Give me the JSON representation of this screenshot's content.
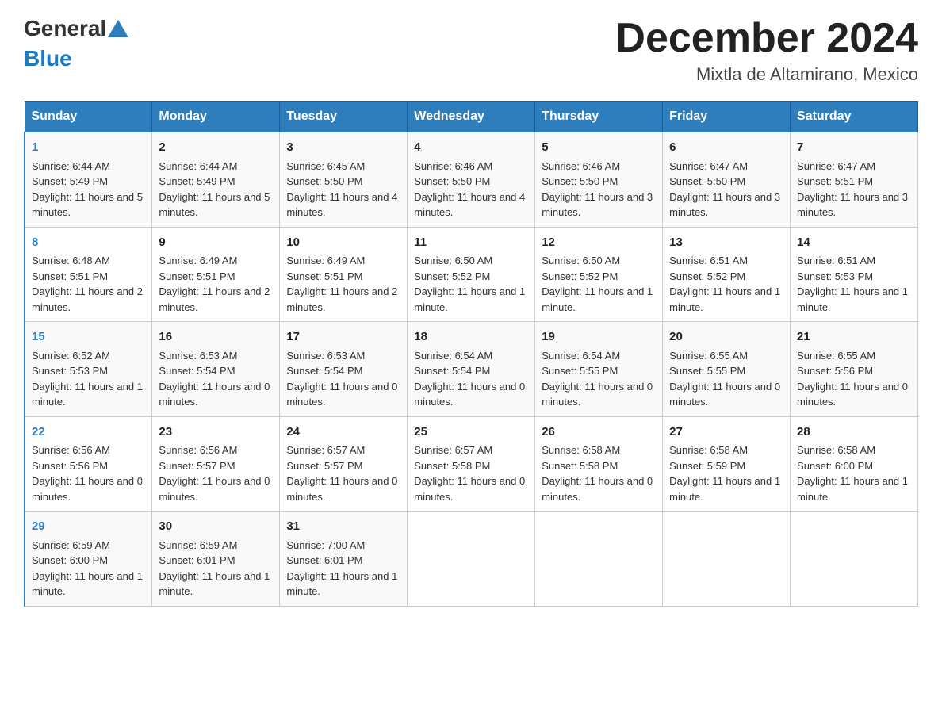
{
  "header": {
    "logo_general": "General",
    "logo_blue": "Blue",
    "title": "December 2024",
    "subtitle": "Mixtla de Altamirano, Mexico"
  },
  "days_of_week": [
    "Sunday",
    "Monday",
    "Tuesday",
    "Wednesday",
    "Thursday",
    "Friday",
    "Saturday"
  ],
  "weeks": [
    [
      {
        "day": "1",
        "sunrise": "6:44 AM",
        "sunset": "5:49 PM",
        "daylight": "11 hours and 5 minutes."
      },
      {
        "day": "2",
        "sunrise": "6:44 AM",
        "sunset": "5:49 PM",
        "daylight": "11 hours and 5 minutes."
      },
      {
        "day": "3",
        "sunrise": "6:45 AM",
        "sunset": "5:50 PM",
        "daylight": "11 hours and 4 minutes."
      },
      {
        "day": "4",
        "sunrise": "6:46 AM",
        "sunset": "5:50 PM",
        "daylight": "11 hours and 4 minutes."
      },
      {
        "day": "5",
        "sunrise": "6:46 AM",
        "sunset": "5:50 PM",
        "daylight": "11 hours and 3 minutes."
      },
      {
        "day": "6",
        "sunrise": "6:47 AM",
        "sunset": "5:50 PM",
        "daylight": "11 hours and 3 minutes."
      },
      {
        "day": "7",
        "sunrise": "6:47 AM",
        "sunset": "5:51 PM",
        "daylight": "11 hours and 3 minutes."
      }
    ],
    [
      {
        "day": "8",
        "sunrise": "6:48 AM",
        "sunset": "5:51 PM",
        "daylight": "11 hours and 2 minutes."
      },
      {
        "day": "9",
        "sunrise": "6:49 AM",
        "sunset": "5:51 PM",
        "daylight": "11 hours and 2 minutes."
      },
      {
        "day": "10",
        "sunrise": "6:49 AM",
        "sunset": "5:51 PM",
        "daylight": "11 hours and 2 minutes."
      },
      {
        "day": "11",
        "sunrise": "6:50 AM",
        "sunset": "5:52 PM",
        "daylight": "11 hours and 1 minute."
      },
      {
        "day": "12",
        "sunrise": "6:50 AM",
        "sunset": "5:52 PM",
        "daylight": "11 hours and 1 minute."
      },
      {
        "day": "13",
        "sunrise": "6:51 AM",
        "sunset": "5:52 PM",
        "daylight": "11 hours and 1 minute."
      },
      {
        "day": "14",
        "sunrise": "6:51 AM",
        "sunset": "5:53 PM",
        "daylight": "11 hours and 1 minute."
      }
    ],
    [
      {
        "day": "15",
        "sunrise": "6:52 AM",
        "sunset": "5:53 PM",
        "daylight": "11 hours and 1 minute."
      },
      {
        "day": "16",
        "sunrise": "6:53 AM",
        "sunset": "5:54 PM",
        "daylight": "11 hours and 0 minutes."
      },
      {
        "day": "17",
        "sunrise": "6:53 AM",
        "sunset": "5:54 PM",
        "daylight": "11 hours and 0 minutes."
      },
      {
        "day": "18",
        "sunrise": "6:54 AM",
        "sunset": "5:54 PM",
        "daylight": "11 hours and 0 minutes."
      },
      {
        "day": "19",
        "sunrise": "6:54 AM",
        "sunset": "5:55 PM",
        "daylight": "11 hours and 0 minutes."
      },
      {
        "day": "20",
        "sunrise": "6:55 AM",
        "sunset": "5:55 PM",
        "daylight": "11 hours and 0 minutes."
      },
      {
        "day": "21",
        "sunrise": "6:55 AM",
        "sunset": "5:56 PM",
        "daylight": "11 hours and 0 minutes."
      }
    ],
    [
      {
        "day": "22",
        "sunrise": "6:56 AM",
        "sunset": "5:56 PM",
        "daylight": "11 hours and 0 minutes."
      },
      {
        "day": "23",
        "sunrise": "6:56 AM",
        "sunset": "5:57 PM",
        "daylight": "11 hours and 0 minutes."
      },
      {
        "day": "24",
        "sunrise": "6:57 AM",
        "sunset": "5:57 PM",
        "daylight": "11 hours and 0 minutes."
      },
      {
        "day": "25",
        "sunrise": "6:57 AM",
        "sunset": "5:58 PM",
        "daylight": "11 hours and 0 minutes."
      },
      {
        "day": "26",
        "sunrise": "6:58 AM",
        "sunset": "5:58 PM",
        "daylight": "11 hours and 0 minutes."
      },
      {
        "day": "27",
        "sunrise": "6:58 AM",
        "sunset": "5:59 PM",
        "daylight": "11 hours and 1 minute."
      },
      {
        "day": "28",
        "sunrise": "6:58 AM",
        "sunset": "6:00 PM",
        "daylight": "11 hours and 1 minute."
      }
    ],
    [
      {
        "day": "29",
        "sunrise": "6:59 AM",
        "sunset": "6:00 PM",
        "daylight": "11 hours and 1 minute."
      },
      {
        "day": "30",
        "sunrise": "6:59 AM",
        "sunset": "6:01 PM",
        "daylight": "11 hours and 1 minute."
      },
      {
        "day": "31",
        "sunrise": "7:00 AM",
        "sunset": "6:01 PM",
        "daylight": "11 hours and 1 minute."
      },
      null,
      null,
      null,
      null
    ]
  ]
}
